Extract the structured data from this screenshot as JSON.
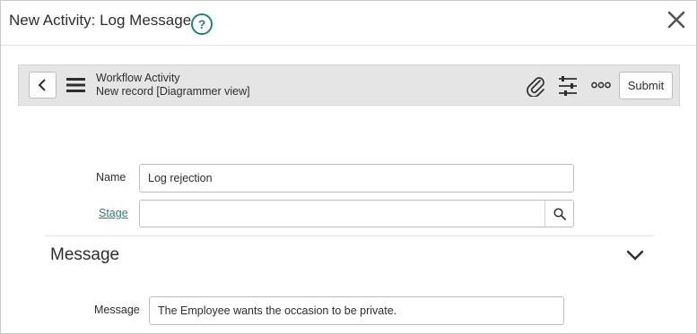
{
  "modal": {
    "title": "New Activity: Log Message",
    "help_glyph": "?",
    "icons": {
      "help": "help-circle-icon",
      "close": "close-icon"
    }
  },
  "toolbar": {
    "record_title": "Workflow Activity",
    "record_subtitle": "New record [Diagrammer view]",
    "submit_label": "Submit",
    "icons": [
      "back-chevron-icon",
      "hamburger-menu-icon",
      "paperclip-icon",
      "sliders-icon",
      "more-options-icon"
    ]
  },
  "form": {
    "name_label": "Name",
    "name_value": "Log rejection",
    "stage_label": "Stage",
    "stage_value": "",
    "stage_lookup_icon": "search-icon"
  },
  "section": {
    "title": "Message",
    "message_label": "Message",
    "message_value": "The Employee wants the occasion to be private."
  },
  "colors": {
    "accent": "#1f8476",
    "toolbar_bg": "#e5e5e5",
    "border": "#bdbdbd",
    "text": "#2e2e2e"
  }
}
